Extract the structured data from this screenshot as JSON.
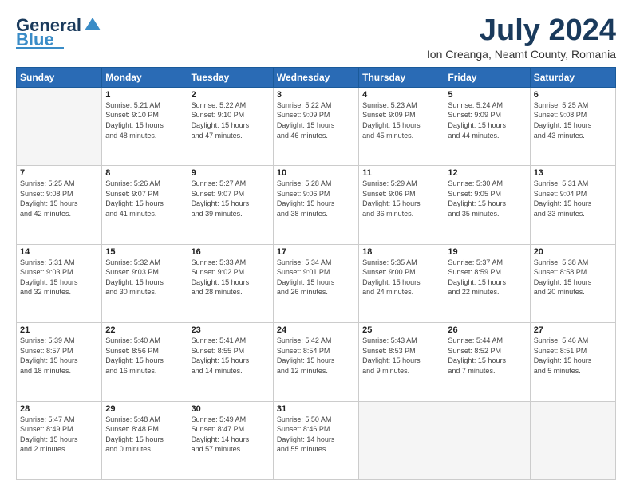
{
  "logo": {
    "line1": "General",
    "line2": "Blue"
  },
  "title": "July 2024",
  "subtitle": "Ion Creanga, Neamt County, Romania",
  "headers": [
    "Sunday",
    "Monday",
    "Tuesday",
    "Wednesday",
    "Thursday",
    "Friday",
    "Saturday"
  ],
  "weeks": [
    [
      {
        "day": "",
        "info": ""
      },
      {
        "day": "1",
        "info": "Sunrise: 5:21 AM\nSunset: 9:10 PM\nDaylight: 15 hours\nand 48 minutes."
      },
      {
        "day": "2",
        "info": "Sunrise: 5:22 AM\nSunset: 9:10 PM\nDaylight: 15 hours\nand 47 minutes."
      },
      {
        "day": "3",
        "info": "Sunrise: 5:22 AM\nSunset: 9:09 PM\nDaylight: 15 hours\nand 46 minutes."
      },
      {
        "day": "4",
        "info": "Sunrise: 5:23 AM\nSunset: 9:09 PM\nDaylight: 15 hours\nand 45 minutes."
      },
      {
        "day": "5",
        "info": "Sunrise: 5:24 AM\nSunset: 9:09 PM\nDaylight: 15 hours\nand 44 minutes."
      },
      {
        "day": "6",
        "info": "Sunrise: 5:25 AM\nSunset: 9:08 PM\nDaylight: 15 hours\nand 43 minutes."
      }
    ],
    [
      {
        "day": "7",
        "info": "Sunrise: 5:25 AM\nSunset: 9:08 PM\nDaylight: 15 hours\nand 42 minutes."
      },
      {
        "day": "8",
        "info": "Sunrise: 5:26 AM\nSunset: 9:07 PM\nDaylight: 15 hours\nand 41 minutes."
      },
      {
        "day": "9",
        "info": "Sunrise: 5:27 AM\nSunset: 9:07 PM\nDaylight: 15 hours\nand 39 minutes."
      },
      {
        "day": "10",
        "info": "Sunrise: 5:28 AM\nSunset: 9:06 PM\nDaylight: 15 hours\nand 38 minutes."
      },
      {
        "day": "11",
        "info": "Sunrise: 5:29 AM\nSunset: 9:06 PM\nDaylight: 15 hours\nand 36 minutes."
      },
      {
        "day": "12",
        "info": "Sunrise: 5:30 AM\nSunset: 9:05 PM\nDaylight: 15 hours\nand 35 minutes."
      },
      {
        "day": "13",
        "info": "Sunrise: 5:31 AM\nSunset: 9:04 PM\nDaylight: 15 hours\nand 33 minutes."
      }
    ],
    [
      {
        "day": "14",
        "info": "Sunrise: 5:31 AM\nSunset: 9:03 PM\nDaylight: 15 hours\nand 32 minutes."
      },
      {
        "day": "15",
        "info": "Sunrise: 5:32 AM\nSunset: 9:03 PM\nDaylight: 15 hours\nand 30 minutes."
      },
      {
        "day": "16",
        "info": "Sunrise: 5:33 AM\nSunset: 9:02 PM\nDaylight: 15 hours\nand 28 minutes."
      },
      {
        "day": "17",
        "info": "Sunrise: 5:34 AM\nSunset: 9:01 PM\nDaylight: 15 hours\nand 26 minutes."
      },
      {
        "day": "18",
        "info": "Sunrise: 5:35 AM\nSunset: 9:00 PM\nDaylight: 15 hours\nand 24 minutes."
      },
      {
        "day": "19",
        "info": "Sunrise: 5:37 AM\nSunset: 8:59 PM\nDaylight: 15 hours\nand 22 minutes."
      },
      {
        "day": "20",
        "info": "Sunrise: 5:38 AM\nSunset: 8:58 PM\nDaylight: 15 hours\nand 20 minutes."
      }
    ],
    [
      {
        "day": "21",
        "info": "Sunrise: 5:39 AM\nSunset: 8:57 PM\nDaylight: 15 hours\nand 18 minutes."
      },
      {
        "day": "22",
        "info": "Sunrise: 5:40 AM\nSunset: 8:56 PM\nDaylight: 15 hours\nand 16 minutes."
      },
      {
        "day": "23",
        "info": "Sunrise: 5:41 AM\nSunset: 8:55 PM\nDaylight: 15 hours\nand 14 minutes."
      },
      {
        "day": "24",
        "info": "Sunrise: 5:42 AM\nSunset: 8:54 PM\nDaylight: 15 hours\nand 12 minutes."
      },
      {
        "day": "25",
        "info": "Sunrise: 5:43 AM\nSunset: 8:53 PM\nDaylight: 15 hours\nand 9 minutes."
      },
      {
        "day": "26",
        "info": "Sunrise: 5:44 AM\nSunset: 8:52 PM\nDaylight: 15 hours\nand 7 minutes."
      },
      {
        "day": "27",
        "info": "Sunrise: 5:46 AM\nSunset: 8:51 PM\nDaylight: 15 hours\nand 5 minutes."
      }
    ],
    [
      {
        "day": "28",
        "info": "Sunrise: 5:47 AM\nSunset: 8:49 PM\nDaylight: 15 hours\nand 2 minutes."
      },
      {
        "day": "29",
        "info": "Sunrise: 5:48 AM\nSunset: 8:48 PM\nDaylight: 15 hours\nand 0 minutes."
      },
      {
        "day": "30",
        "info": "Sunrise: 5:49 AM\nSunset: 8:47 PM\nDaylight: 14 hours\nand 57 minutes."
      },
      {
        "day": "31",
        "info": "Sunrise: 5:50 AM\nSunset: 8:46 PM\nDaylight: 14 hours\nand 55 minutes."
      },
      {
        "day": "",
        "info": ""
      },
      {
        "day": "",
        "info": ""
      },
      {
        "day": "",
        "info": ""
      }
    ]
  ]
}
